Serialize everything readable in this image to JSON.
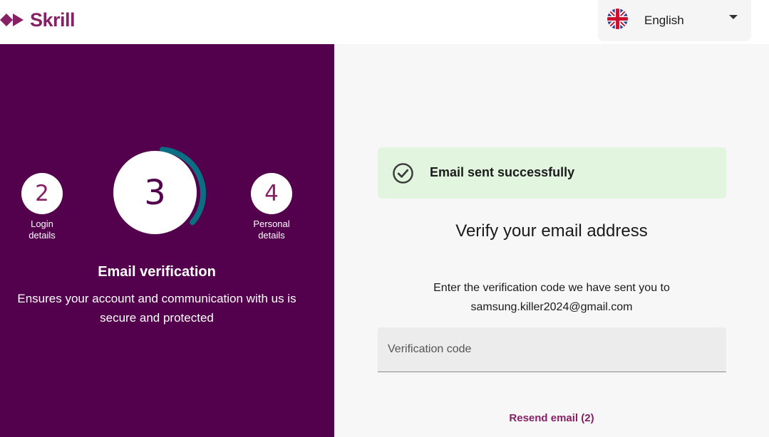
{
  "header": {
    "logo_text": "Skrill",
    "language": {
      "label": "English",
      "flag_icon": "uk-flag-icon"
    }
  },
  "stepper": {
    "prev_step": {
      "number": "2",
      "label_line1": "Login",
      "label_line2": "details"
    },
    "current_step": {
      "number": "3",
      "progress": 0.35
    },
    "next_step": {
      "number": "4",
      "label_line1": "Personal",
      "label_line2": "details"
    },
    "title": "Email verification",
    "description": "Ensures your account and communication with us is secure and protected"
  },
  "main": {
    "alert": {
      "text": "Email sent successfully",
      "icon": "check-circle-icon"
    },
    "title": "Verify your email address",
    "instruction": "Enter the verification code we have sent you to",
    "email": "samsung.killer2024@gmail.com",
    "code_field": {
      "placeholder": "Verification code",
      "value": ""
    },
    "resend_label": "Resend email (2)"
  },
  "colors": {
    "brand": "#862165",
    "panel": "#53004d",
    "ring": "#0b6e82",
    "success_bg": "#e2f6df"
  }
}
